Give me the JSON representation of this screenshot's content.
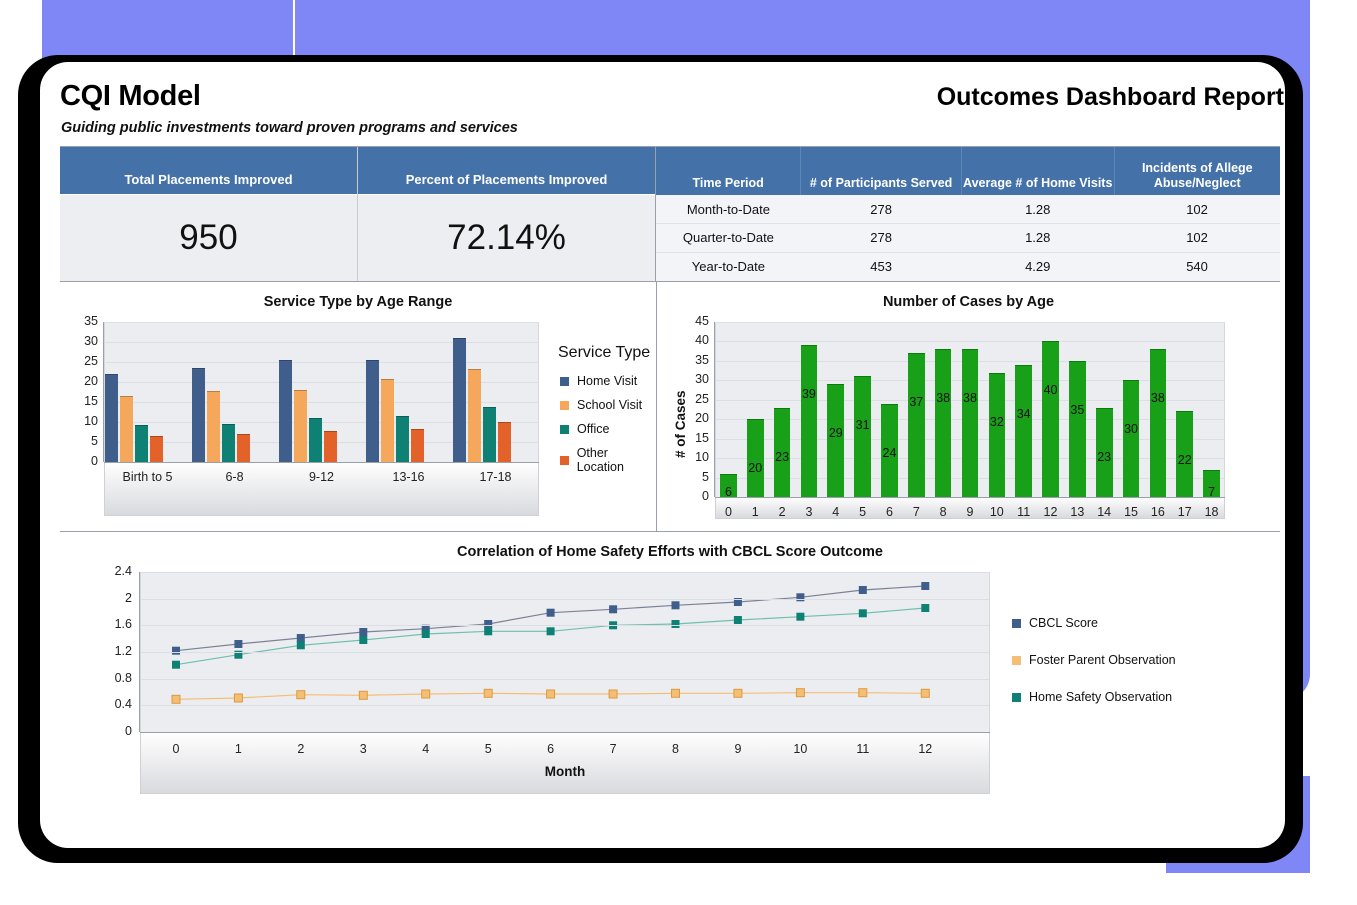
{
  "header": {
    "title": "CQI Model",
    "subtitle": "Guiding public investments toward proven programs and services",
    "right_title": "Outcomes Dashboard Report"
  },
  "kpis": [
    {
      "label": "Total Placements Improved",
      "value": "950"
    },
    {
      "label": "Percent of Placements Improved",
      "value": "72.14%"
    }
  ],
  "period_table": {
    "columns": [
      "Time Period",
      "# of Participants Served",
      "Average # of Home Visits",
      "Incidents of Allege Abuse/Neglect"
    ],
    "rows": [
      [
        "Month-to-Date",
        "278",
        "1.28",
        "102"
      ],
      [
        "Quarter-to-Date",
        "278",
        "1.28",
        "102"
      ],
      [
        "Year-to-Date",
        "453",
        "4.29",
        "540"
      ]
    ]
  },
  "colors": {
    "header_blue": "#4472A8",
    "backdrop_purple": "#7F87F7",
    "home_visit": "#3F5E8C",
    "school_visit": "#F5A85C",
    "office": "#0E8074",
    "other_location": "#E2622A",
    "cases_green": "#19A019",
    "cbcl": "#3F5E8C",
    "foster": "#F5BE74",
    "home_safety": "#0E8074"
  },
  "chart_data": [
    {
      "type": "bar",
      "title": "Service Type by Age Range",
      "xlabel": "",
      "ylabel": "",
      "ylim": [
        0,
        35
      ],
      "yticks": [
        0,
        5,
        10,
        15,
        20,
        25,
        30,
        35
      ],
      "grid": true,
      "legend_title": "Service Type",
      "legend_position": "right",
      "categories": [
        "Birth to 5",
        "6-8",
        "9-12",
        "13-16",
        "17-18"
      ],
      "series": [
        {
          "name": "Home Visit",
          "color": "#3F5E8C",
          "values": [
            22.1,
            23.4,
            25.5,
            25.5,
            31.1
          ]
        },
        {
          "name": "School Visit",
          "color": "#F5A85C",
          "values": [
            16.4,
            17.8,
            18.0,
            20.7,
            23.2
          ]
        },
        {
          "name": "Office",
          "color": "#0E8074",
          "values": [
            9.2,
            9.5,
            11.0,
            11.4,
            13.8
          ]
        },
        {
          "name": "Other Location",
          "color": "#E2622A",
          "values": [
            6.6,
            7.1,
            7.7,
            8.2,
            9.9
          ]
        }
      ]
    },
    {
      "type": "bar",
      "title": "Number of Cases by Age",
      "xlabel": "",
      "ylabel": "# of Cases",
      "ylim": [
        0,
        45
      ],
      "yticks": [
        0,
        5,
        10,
        15,
        20,
        25,
        30,
        35,
        40,
        45
      ],
      "grid": true,
      "data_labels": true,
      "categories": [
        "0",
        "1",
        "2",
        "3",
        "4",
        "5",
        "6",
        "7",
        "8",
        "9",
        "10",
        "11",
        "12",
        "13",
        "14",
        "15",
        "16",
        "17",
        "18"
      ],
      "values": [
        6,
        20,
        23,
        39,
        29,
        31,
        24,
        37,
        38,
        38,
        32,
        34,
        40,
        35,
        23,
        30,
        38,
        22,
        7
      ],
      "series_color": "#19A019"
    },
    {
      "type": "line",
      "title": "Correlation of Home Safety Efforts with CBCL Score Outcome",
      "xlabel": "Month",
      "ylabel": "",
      "ylim": [
        0,
        2.4
      ],
      "yticks": [
        0,
        0.4,
        0.8,
        1.2,
        1.6,
        2,
        2.4
      ],
      "ytick_labels": [
        "0",
        "0.4",
        "0.8",
        "1.2",
        "1.6",
        "2",
        "2.4"
      ],
      "grid": true,
      "legend_position": "right",
      "x": [
        0,
        1,
        2,
        3,
        4,
        5,
        6,
        7,
        8,
        9,
        10,
        11,
        12
      ],
      "series": [
        {
          "name": "CBCL Score",
          "color": "#3F5E8C",
          "values": [
            1.22,
            1.32,
            1.41,
            1.5,
            1.55,
            1.62,
            1.79,
            1.84,
            1.9,
            1.95,
            2.02,
            2.13,
            2.19
          ]
        },
        {
          "name": "Foster Parent Observation",
          "color": "#F5BE74",
          "values": [
            0.49,
            0.51,
            0.56,
            0.55,
            0.57,
            0.58,
            0.57,
            0.57,
            0.58,
            0.58,
            0.59,
            0.59,
            0.58
          ]
        },
        {
          "name": "Home Safety Observation",
          "color": "#0E8074",
          "values": [
            1.01,
            1.16,
            1.3,
            1.38,
            1.47,
            1.51,
            1.51,
            1.6,
            1.62,
            1.68,
            1.73,
            1.78,
            1.86
          ]
        }
      ]
    }
  ]
}
